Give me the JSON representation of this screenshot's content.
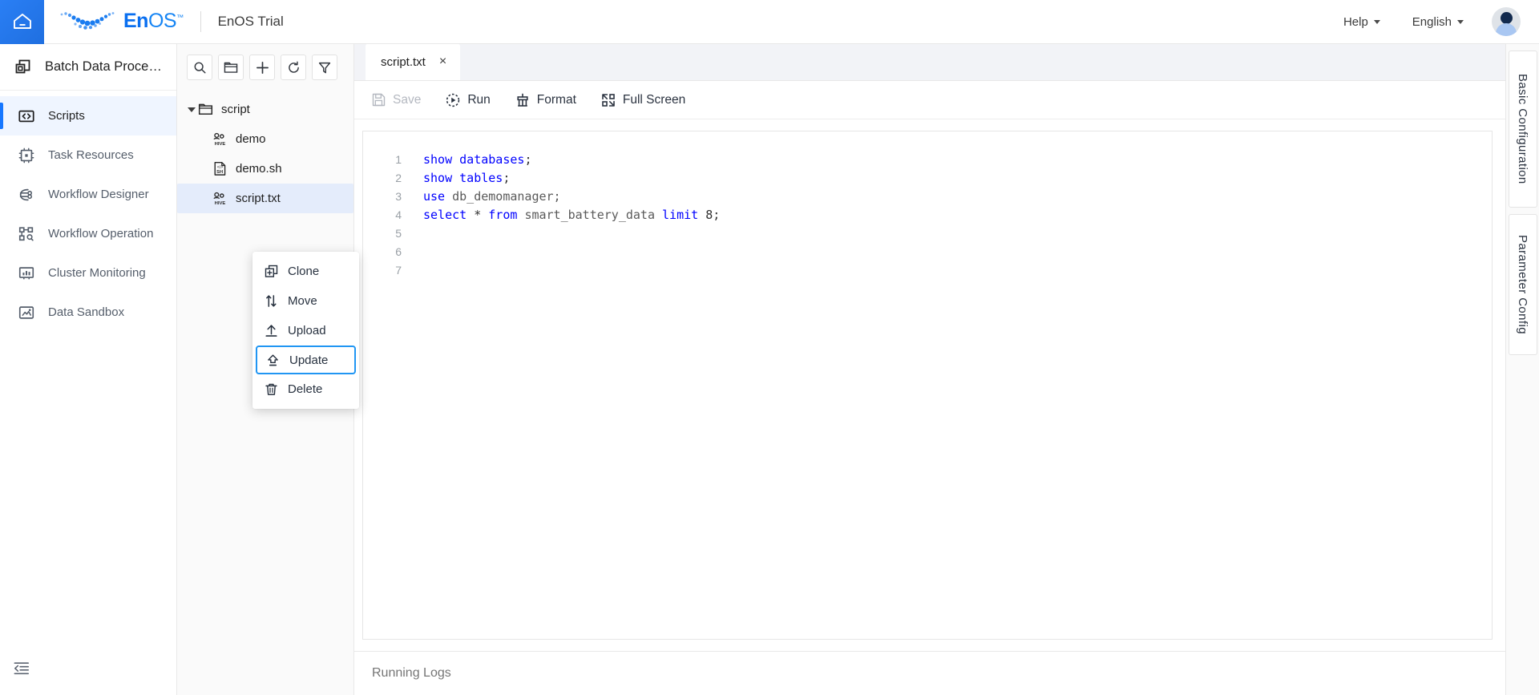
{
  "header": {
    "home_icon": "home-icon",
    "brand_en": "En",
    "brand_os": "OS",
    "brand_tm": "™",
    "product": "EnOS Trial",
    "help_label": "Help",
    "language_label": "English",
    "avatar": "user-avatar"
  },
  "sidebar": {
    "title": "Batch Data Proce…",
    "items": [
      {
        "label": "Scripts",
        "icon": "code-brackets-icon",
        "active": true
      },
      {
        "label": "Task Resources",
        "icon": "chip-icon",
        "active": false
      },
      {
        "label": "Workflow Designer",
        "icon": "workflow-designer-icon",
        "active": false
      },
      {
        "label": "Workflow Operation",
        "icon": "workflow-operation-icon",
        "active": false
      },
      {
        "label": "Cluster Monitoring",
        "icon": "monitor-chart-icon",
        "active": false
      },
      {
        "label": "Data Sandbox",
        "icon": "sandbox-icon",
        "active": false
      }
    ],
    "collapse_icon": "collapse-sidebar-icon"
  },
  "tree": {
    "toolbar": [
      {
        "name": "search-icon",
        "title": "Search"
      },
      {
        "name": "new-folder-icon",
        "title": "New Folder"
      },
      {
        "name": "plus-icon",
        "title": "Add"
      },
      {
        "name": "refresh-icon",
        "title": "Refresh"
      },
      {
        "name": "filter-icon",
        "title": "Filter"
      }
    ],
    "nodes": [
      {
        "label": "script",
        "type": "folder",
        "expanded": true,
        "indent": 0,
        "selected": false
      },
      {
        "label": "demo",
        "type": "hive",
        "indent": 1,
        "selected": false
      },
      {
        "label": "demo.sh",
        "type": "sh",
        "indent": 1,
        "selected": false
      },
      {
        "label": "script.txt",
        "type": "hive",
        "indent": 1,
        "selected": true
      }
    ]
  },
  "context_menu": {
    "items": [
      {
        "label": "Clone",
        "icon": "clone-icon",
        "highlighted": false
      },
      {
        "label": "Move",
        "icon": "move-arrows-icon",
        "highlighted": false
      },
      {
        "label": "Upload",
        "icon": "upload-icon",
        "highlighted": false
      },
      {
        "label": "Update",
        "icon": "update-icon",
        "highlighted": true
      },
      {
        "label": "Delete",
        "icon": "trash-icon",
        "highlighted": false
      }
    ],
    "highlight_color": "#2196f3"
  },
  "editor": {
    "tab_label": "script.txt",
    "tab_close": "×",
    "toolbar": [
      {
        "label": "Save",
        "icon": "save-disk-icon",
        "disabled": true
      },
      {
        "label": "Run",
        "icon": "run-play-icon",
        "disabled": false
      },
      {
        "label": "Format",
        "icon": "format-brush-icon",
        "disabled": false
      },
      {
        "label": "Full Screen",
        "icon": "fullscreen-icon",
        "disabled": false
      }
    ],
    "lines": [
      {
        "n": "1",
        "tokens": [
          {
            "t": "show databases",
            "c": "kw"
          },
          {
            "t": ";",
            "c": "pn"
          }
        ]
      },
      {
        "n": "2",
        "tokens": [
          {
            "t": "show tables",
            "c": "kw"
          },
          {
            "t": ";",
            "c": "pn"
          }
        ]
      },
      {
        "n": "3",
        "tokens": [
          {
            "t": "use ",
            "c": "kw"
          },
          {
            "t": "db_demomanager;",
            "c": "id"
          }
        ]
      },
      {
        "n": "4",
        "tokens": [
          {
            "t": "select ",
            "c": "kw"
          },
          {
            "t": "* ",
            "c": "pn"
          },
          {
            "t": "from ",
            "c": "kw"
          },
          {
            "t": "smart_battery_data ",
            "c": "id"
          },
          {
            "t": "limit ",
            "c": "kw"
          },
          {
            "t": "8;",
            "c": "num"
          }
        ]
      },
      {
        "n": "5",
        "tokens": []
      },
      {
        "n": "6",
        "tokens": []
      },
      {
        "n": "7",
        "tokens": []
      }
    ],
    "logs_label": "Running Logs"
  },
  "right_rail": {
    "tabs": [
      {
        "label": "Basic Configuration"
      },
      {
        "label": "Parameter Config"
      }
    ]
  }
}
